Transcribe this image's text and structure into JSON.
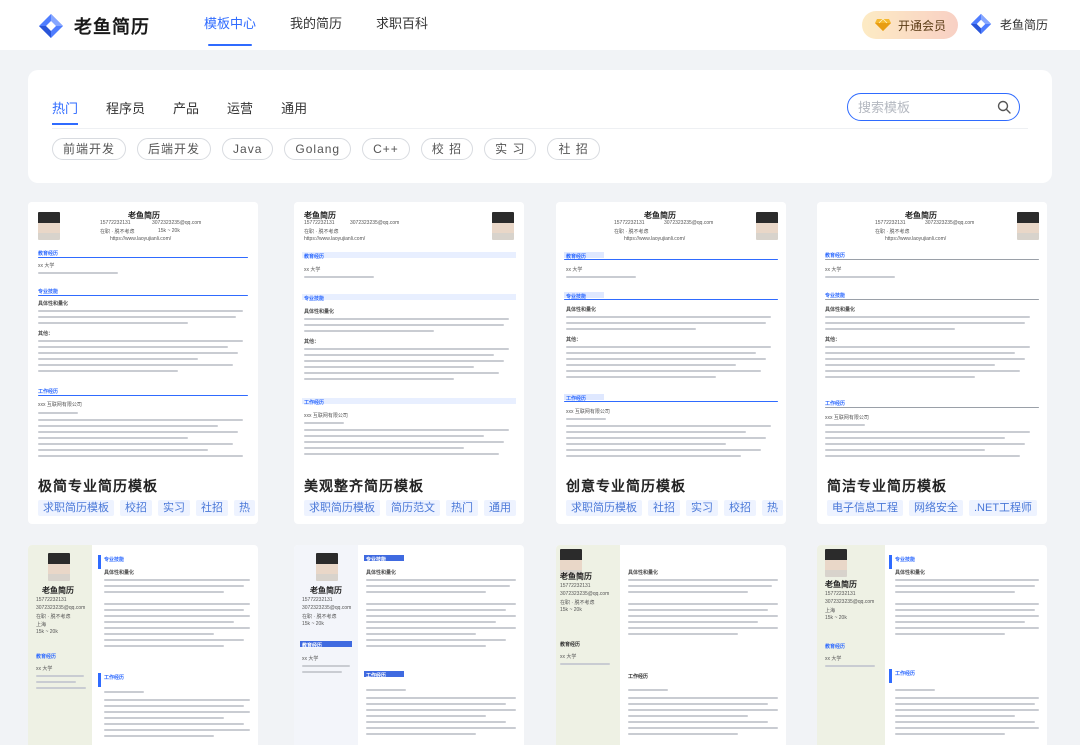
{
  "header": {
    "logo_text": "老鱼简历",
    "nav": [
      {
        "label": "模板中心",
        "active": true
      },
      {
        "label": "我的简历",
        "active": false
      },
      {
        "label": "求职百科",
        "active": false
      }
    ],
    "vip_label": "开通会员",
    "user_name": "老鱼简历"
  },
  "filter": {
    "categories": [
      {
        "label": "热门",
        "active": true
      },
      {
        "label": "程序员",
        "active": false
      },
      {
        "label": "产品",
        "active": false
      },
      {
        "label": "运营",
        "active": false
      },
      {
        "label": "通用",
        "active": false
      }
    ],
    "search_placeholder": "搜索模板",
    "tags": [
      "前端开发",
      "后端开发",
      "Java",
      "Golang",
      "C++",
      "校 招",
      "实 习",
      "社 招"
    ]
  },
  "resume_common": {
    "name": "老鱼简历",
    "phone": "15772232131",
    "email": "3072323235@qq.com",
    "status": "在职 · 脱不考虑",
    "city": "上海",
    "salary": "15k ~ 20k",
    "degree": "本科",
    "site": "https://www.laoyujianli.com/",
    "edu_head": "教育经历",
    "skill_head": "专业技能",
    "work_head": "工作经历",
    "school": "xx 大学",
    "company": "xxx 互联网有限公司",
    "skill_title": "具体性和量化",
    "other": "其他："
  },
  "cards": [
    {
      "title": "极简专业简历模板",
      "tags": [
        "求职简历模板",
        "校招",
        "实习",
        "社招",
        "热"
      ]
    },
    {
      "title": "美观整齐简历模板",
      "tags": [
        "求职简历模板",
        "简历范文",
        "热门",
        "通用"
      ]
    },
    {
      "title": "创意专业简历模板",
      "tags": [
        "求职简历模板",
        "社招",
        "实习",
        "校招",
        "热"
      ]
    },
    {
      "title": "简洁专业简历模板",
      "tags": [
        "电子信息工程",
        "网络安全",
        ".NET工程师"
      ]
    }
  ],
  "colors": {
    "accent": "#2f6bff",
    "background": "#f1f3f6",
    "tag_bg": "#eef3ff",
    "vip_gradient_start": "#fdebc4"
  },
  "icons": {
    "logo": "logo-mark-icon",
    "vip": "diamond-icon",
    "search": "search-icon"
  }
}
